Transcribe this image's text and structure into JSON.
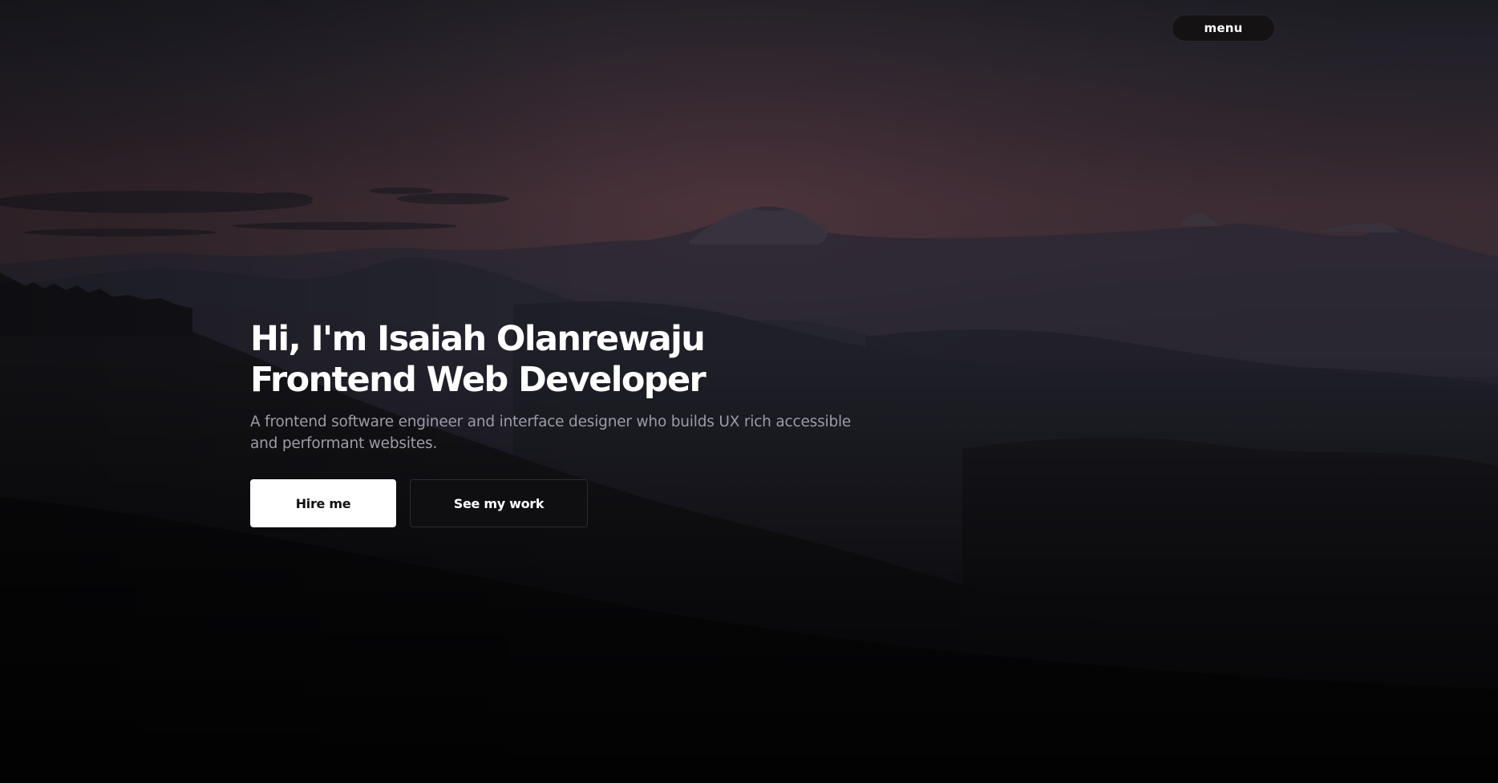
{
  "header": {
    "menu_label": "menu"
  },
  "hero": {
    "title_line1": "Hi, I'm Isaiah Olanrewaju",
    "title_line2": "Frontend Web Developer",
    "description": "A frontend software engineer and interface designer who builds UX rich accessible and performant websites.",
    "primary_button": "Hire me",
    "secondary_button": "See my work"
  },
  "colors": {
    "sky_top": "#1f1e26",
    "sky_glow": "#4b3238",
    "ground": "#09090b",
    "primary_button_bg": "#ffffff",
    "secondary_button_bg": "#0f0f12",
    "menu_bg": "#151214",
    "description_text": "#9c9ca6"
  }
}
